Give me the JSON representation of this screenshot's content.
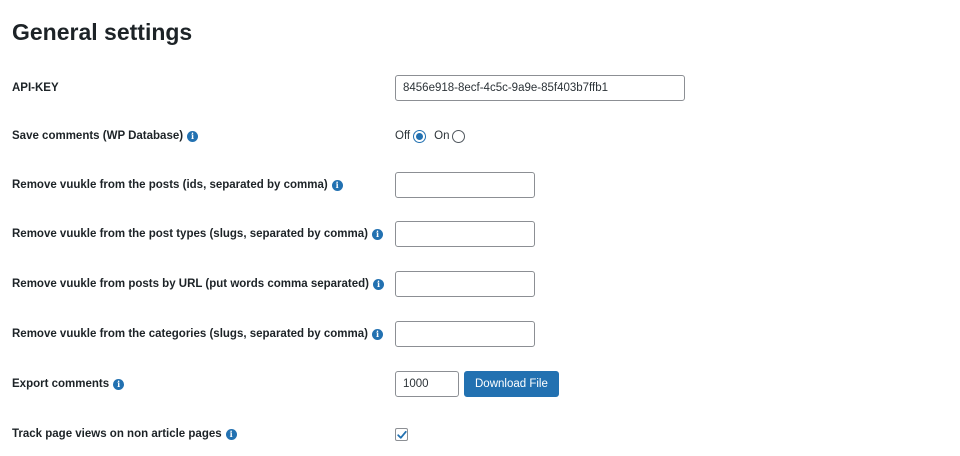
{
  "page": {
    "title": "General settings"
  },
  "api_key": {
    "label": "API-KEY",
    "value": "8456e918-8ecf-4c5c-9a9e-85f403b7ffb1"
  },
  "save_comments": {
    "label": "Save comments (WP Database)",
    "off_label": "Off",
    "on_label": "On",
    "selected": "Off"
  },
  "remove_posts": {
    "label": "Remove vuukle from the posts (ids, separated by comma)",
    "value": ""
  },
  "remove_post_types": {
    "label": "Remove vuukle from the post types (slugs, separated by comma)",
    "value": ""
  },
  "remove_by_url": {
    "label": "Remove vuukle from posts by URL (put words comma separated)",
    "value": ""
  },
  "remove_categories": {
    "label": "Remove vuukle from the categories (slugs, separated by comma)",
    "value": ""
  },
  "export_comments": {
    "label": "Export comments",
    "value": "1000",
    "button_label": "Download File"
  },
  "track_views": {
    "label": "Track page views on non article pages",
    "checked": true
  },
  "icons": {
    "info": "info-icon",
    "info_glyph": "i",
    "check": "checkmark-icon"
  },
  "colors": {
    "accent": "#2271b1",
    "text": "#1d2327",
    "border": "#8c8f94"
  }
}
